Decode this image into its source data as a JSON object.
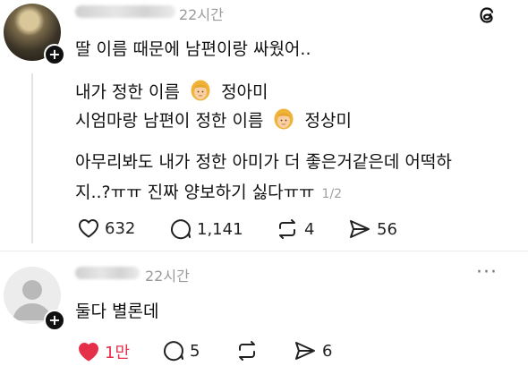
{
  "post": {
    "time": "22시간",
    "line1": "딸 이름 때문에 남편이랑 싸웠어..",
    "mine_prefix": "내가 정한 이름",
    "mine_name": "정아미",
    "theirs_prefix": "시엄마랑 남편이 정한 이름",
    "theirs_name": "정상미",
    "body_line1": "아무리봐도 내가 정한 아미가 더 좋은거같은데 어떡하",
    "body_line2": "지..?ㅠㅠ 진짜 양보하기 싫다ㅠㅠ",
    "page_indicator": "1/2",
    "likes": "632",
    "comments": "1,141",
    "reposts": "4",
    "shares": "56"
  },
  "reply": {
    "time": "22시간",
    "text": "둘다 별론데",
    "likes": "1만",
    "comments": "5",
    "shares": "6",
    "more": "···"
  },
  "icons": {
    "app_logo": "threads-icon",
    "like": "heart-icon",
    "comment": "comment-icon",
    "repost": "repost-icon",
    "share": "send-icon"
  },
  "colors": {
    "liked": "#e5304a",
    "muted": "#9a9a9a"
  }
}
